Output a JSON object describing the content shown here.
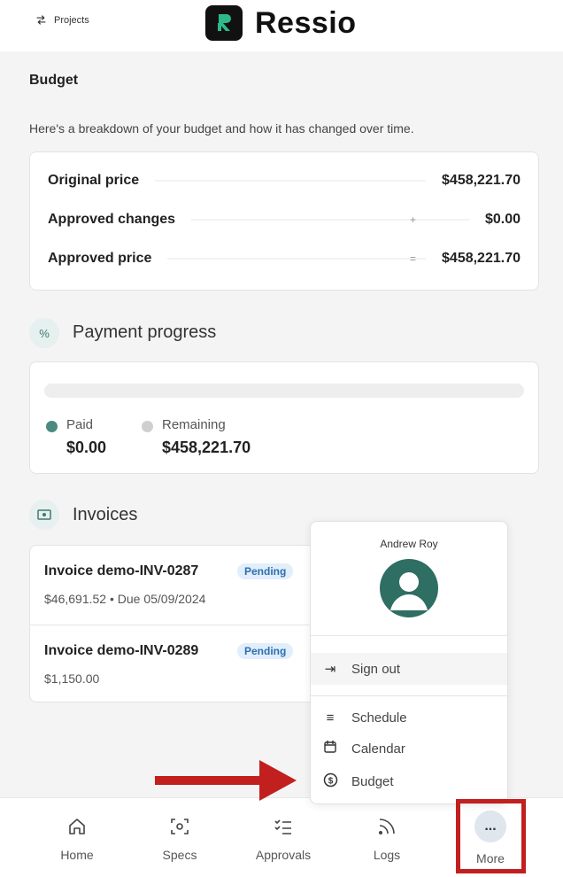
{
  "header": {
    "projects_label": "Projects",
    "brand": "Ressio"
  },
  "budget": {
    "title": "Budget",
    "description": "Here's a breakdown of your budget and how it has changed over time.",
    "rows": [
      {
        "label": "Original price",
        "sign": "",
        "value": "$458,221.70"
      },
      {
        "label": "Approved changes",
        "sign": "+",
        "value": "$0.00"
      },
      {
        "label": "Approved price",
        "sign": "=",
        "value": "$458,221.70"
      }
    ]
  },
  "payment_progress": {
    "title": "Payment progress",
    "icon": "%",
    "paid_fraction": 0,
    "paid_label": "Paid",
    "paid_value": "$0.00",
    "remaining_label": "Remaining",
    "remaining_value": "$458,221.70",
    "colors": {
      "paid": "#4a8a80",
      "remaining": "#cfcfcf"
    }
  },
  "invoices": {
    "title": "Invoices",
    "items": [
      {
        "name": "Invoice demo-INV-0287",
        "status": "Pending",
        "sub": "$46,691.52 • Due 05/09/2024"
      },
      {
        "name": "Invoice demo-INV-0289",
        "status": "Pending",
        "sub": "$1,150.00"
      }
    ]
  },
  "menu": {
    "user_name": "Andrew Roy",
    "sign_out": "Sign out",
    "items": [
      "Schedule",
      "Calendar",
      "Budget"
    ]
  },
  "nav": {
    "items": [
      "Home",
      "Specs",
      "Approvals",
      "Logs",
      "More"
    ],
    "more_glyph": "..."
  },
  "colors": {
    "accent": "#3f7a70",
    "annotation_red": "#c21f1f"
  }
}
